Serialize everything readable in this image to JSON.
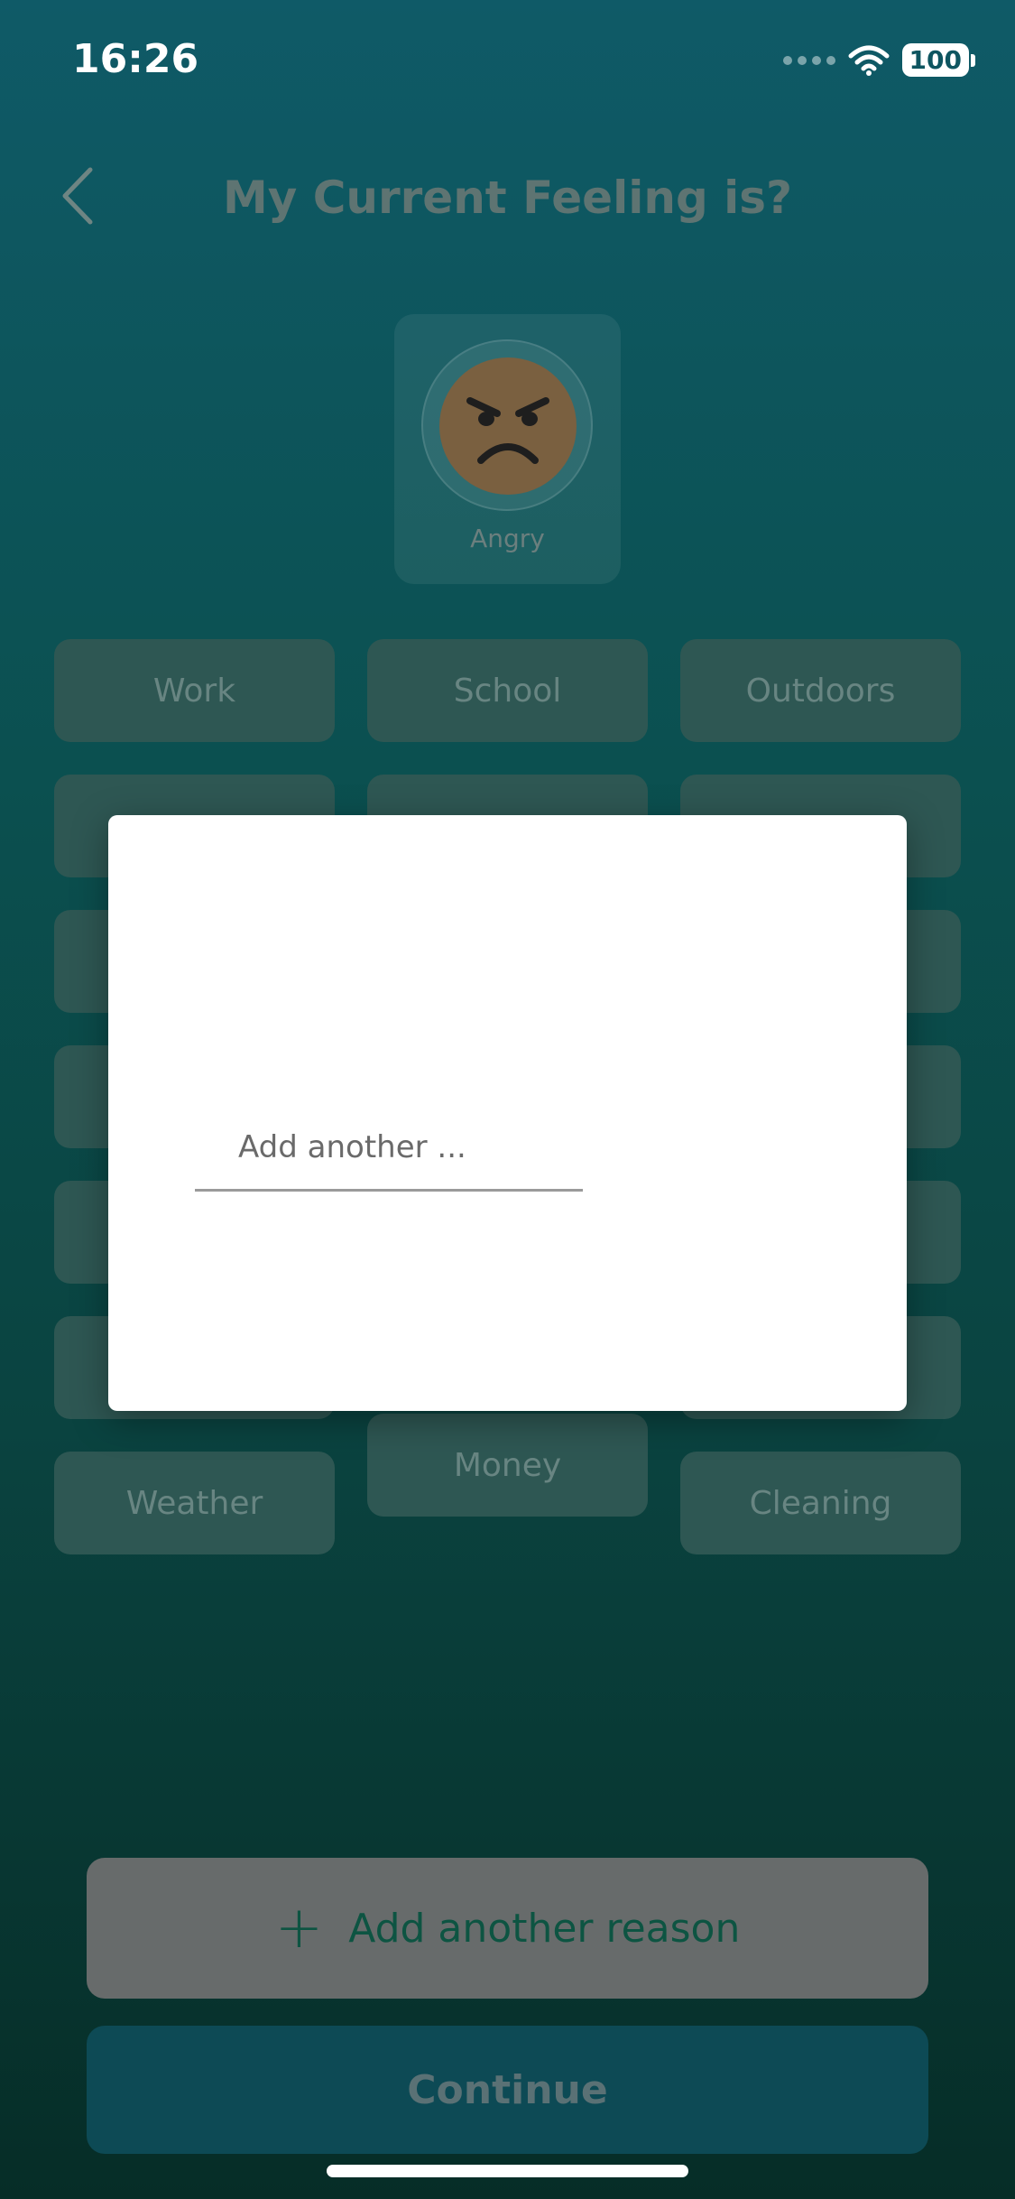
{
  "status_bar": {
    "time": "16:26",
    "battery": "100"
  },
  "header": {
    "title": "My Current Feeling is?"
  },
  "mood": {
    "label": "Angry"
  },
  "reasons": {
    "row1": [
      "Work",
      "School",
      "Outdoors"
    ],
    "money": "Money",
    "weather": "Weather",
    "cleaning": "Cleaning"
  },
  "modal": {
    "input_placeholder": "Add another ...",
    "input_value": ""
  },
  "actions": {
    "add_reason_label": "Add another reason",
    "continue_label": "Continue"
  },
  "icons": {
    "back": "chevron-left-icon",
    "wifi": "wifi-icon",
    "cellular": "cellular-dots-icon",
    "battery": "battery-icon",
    "mood": "angry-face-icon",
    "add": "plus-icon"
  }
}
